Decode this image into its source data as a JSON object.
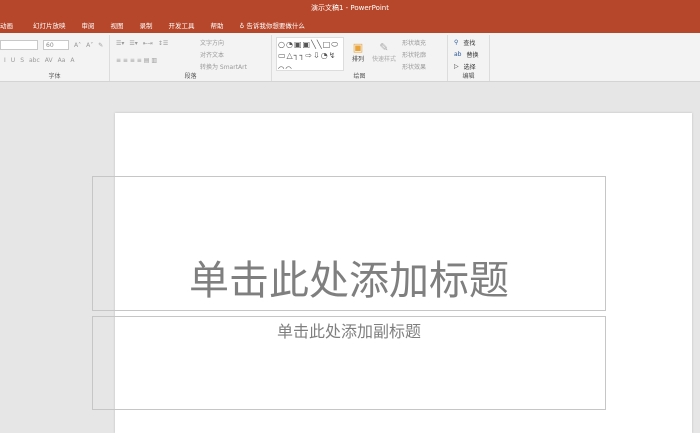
{
  "window": {
    "title": "演示文稿1  -  PowerPoint"
  },
  "tabs": [
    "动画",
    "幻灯片放映",
    "审阅",
    "视图",
    "录制",
    "开发工具",
    "帮助"
  ],
  "tell_me": "告诉我你想要做什么",
  "font": {
    "size": "60",
    "label": "字体",
    "buttons": [
      "I",
      "U",
      "S",
      "abc",
      "AV",
      "Aa",
      "A"
    ]
  },
  "paragraph": {
    "label": "段落",
    "text_direction": "文字方向",
    "align_text": "对齐文本",
    "smartart": "转换为 SmartArt"
  },
  "drawing": {
    "label": "绘图",
    "arrange": "排列",
    "quick_styles": "快速样式",
    "shape_fill": "形状填充",
    "shape_outline": "形状轮廓",
    "shape_effects": "形状效果",
    "shapes": "○◔▣▣╲╲□⬭▭△┐┐⇨⇩◔↯⌒⌒"
  },
  "editing": {
    "label": "编辑",
    "find": "查找",
    "replace": "替换",
    "select": "选择"
  },
  "slide": {
    "title_placeholder": "单击此处添加标题",
    "subtitle_placeholder": "单击此处添加副标题"
  },
  "colors": {
    "accent": "#b7472a"
  }
}
